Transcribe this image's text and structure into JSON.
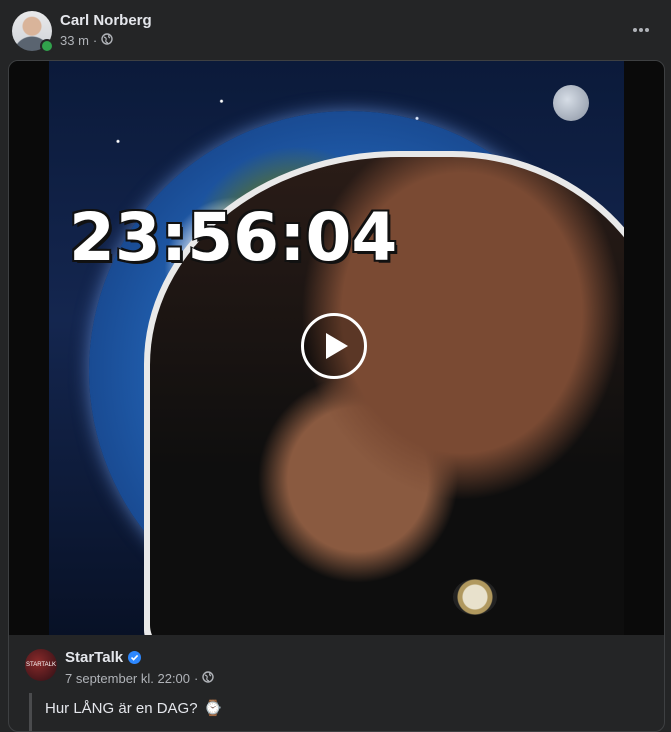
{
  "post": {
    "author": "Carl Norberg",
    "time": "33 m",
    "separator": "·",
    "privacy_icon": "globe-icon",
    "more_icon": "ellipsis-icon"
  },
  "video": {
    "overlay_text": "23:56:04",
    "play_icon": "play-icon"
  },
  "source": {
    "name": "StarTalk",
    "avatar_text": "STARTALK",
    "verified_icon": "verified-badge-icon",
    "date": "7 september kl. 22:00",
    "separator": "·",
    "text": "Hur LÅNG är en DAG?",
    "emoji": "⌚"
  },
  "colors": {
    "background": "#242526",
    "text": "#e4e6eb",
    "secondary_text": "#b0b3b8",
    "online": "#31a24c",
    "verified": "#2d88ff"
  }
}
